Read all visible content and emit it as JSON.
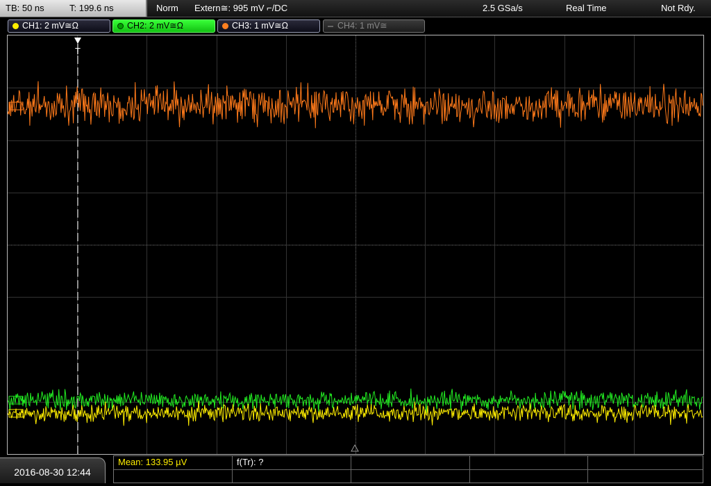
{
  "status": {
    "timebase": "TB: 50 ns",
    "trigger_time": "T: 199.6 ns",
    "acq_mode": "Norm",
    "trigger_source": "Extern≅: 995 mV ⌐/DC",
    "sample_rate": "2.5 GSa/s",
    "mode": "Real Time",
    "state": "Not Rdy."
  },
  "channels": [
    {
      "label": "CH1: 2 mV≅Ω",
      "color": "#ffee00",
      "active": true
    },
    {
      "label": "CH2: 2 mV≅Ω",
      "color": "#22ee22",
      "active": true,
      "selected": true
    },
    {
      "label": "CH3: 1 mV≅Ω",
      "color": "#ff7a1a",
      "active": true
    },
    {
      "label": "CH4: 1 mV≅",
      "color": "#777777",
      "active": false
    }
  ],
  "measurements": {
    "mean": "Mean: 133.95 µV",
    "freq": "f(Tr): ?"
  },
  "datetime": "2016-08-30 12:44",
  "marker_label": "T"
}
